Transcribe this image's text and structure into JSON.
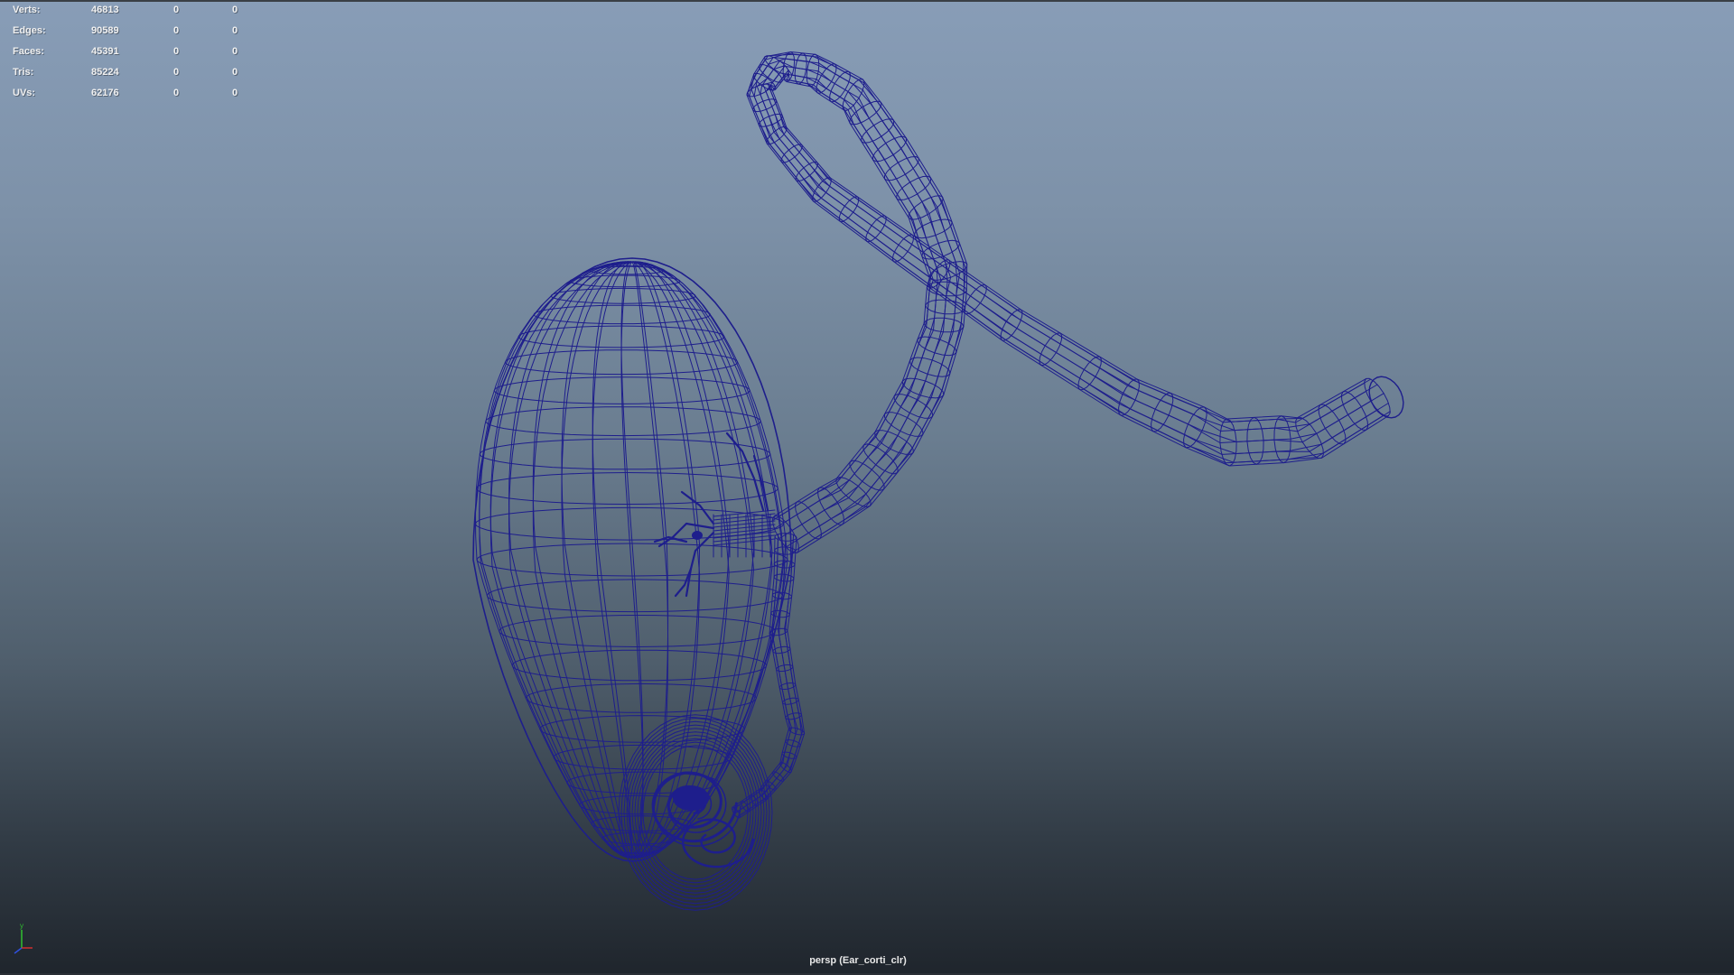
{
  "hud": {
    "rows": [
      {
        "label": "Verts:",
        "value": "46813",
        "selected": "0",
        "triangles": "0"
      },
      {
        "label": "Edges:",
        "value": "90589",
        "selected": "0",
        "triangles": "0"
      },
      {
        "label": "Faces:",
        "value": "45391",
        "selected": "0",
        "triangles": "0"
      },
      {
        "label": "Tris:",
        "value": "85224",
        "selected": "0",
        "triangles": "0"
      },
      {
        "label": "UVs:",
        "value": "62176",
        "selected": "0",
        "triangles": "0"
      }
    ]
  },
  "viewport": {
    "camera_label": "persp (Ear_corti_clr)",
    "background_top": "#889db7",
    "background_bottom": "#1f252c",
    "wireframe_color": "#1e1e8c"
  },
  "axis_gizmo": {
    "y_label": "y",
    "x_color": "#d03030",
    "y_color": "#30c030",
    "z_color": "#3050e0"
  }
}
